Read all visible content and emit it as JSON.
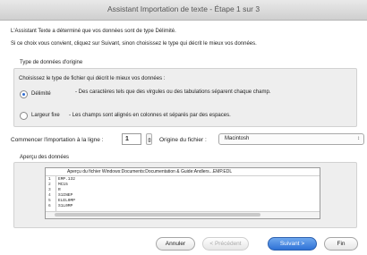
{
  "window": {
    "title": "Assistant Importation de texte - Étape 1 sur 3"
  },
  "intro": {
    "line1": "L'Assistant Texte a déterminé que vos données sont de type Délimité.",
    "line2": "Si ce choix vous convient, cliquez sur Suivant, sinon choisissez le type qui décrit le mieux vos données."
  },
  "data_type": {
    "group_title": "Type de données d'origine",
    "prompt": "Choisissez le type de fichier qui décrit le mieux vos données :",
    "options": [
      {
        "label": "Délimité",
        "description": "- Des caractères tels que des virgules ou des tabulations séparent chaque champ.",
        "selected": true
      },
      {
        "label": "Largeur fixe",
        "description": "- Les champs sont alignés en colonnes et séparés par des espaces.",
        "selected": false
      }
    ]
  },
  "import": {
    "start_label": "Commencer l'importation à la ligne :",
    "start_value": "1",
    "origin_label": "Origine du fichier :",
    "origin_value": "Macintosh"
  },
  "preview": {
    "title": "Aperçu des données",
    "header": "Aperçu du fichier Windows:Documents:Documentation & Guide:Andlers...EMP.EDL",
    "rows": [
      {
        "num": "1",
        "text": "EMP.132"
      },
      {
        "num": "2",
        "text": "MC15"
      },
      {
        "num": "3",
        "text": "R"
      },
      {
        "num": "4",
        "text": "S1INEP"
      },
      {
        "num": "5",
        "text": "ELEL0MP"
      },
      {
        "num": "6",
        "text": "S1L0MP"
      }
    ]
  },
  "buttons": {
    "cancel": "Annuler",
    "previous": "< Précédent",
    "next": "Suivant >",
    "finish": "Fin"
  }
}
